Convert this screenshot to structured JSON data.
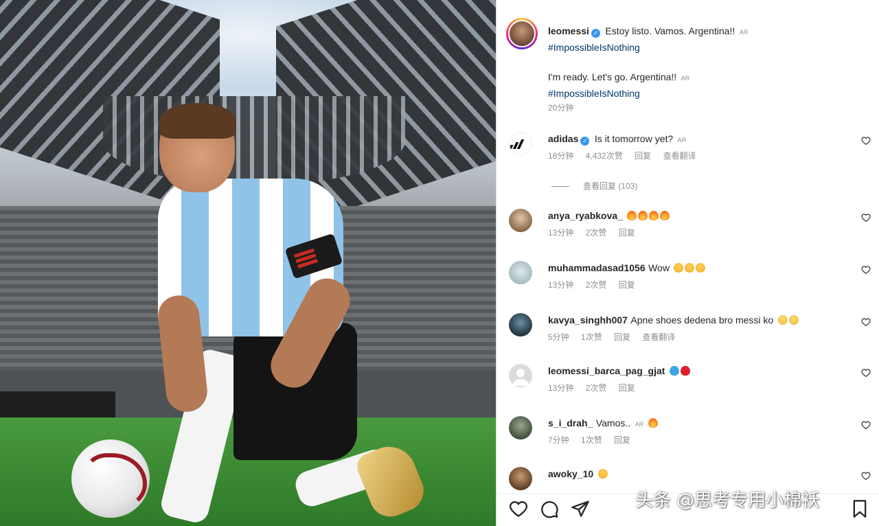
{
  "post": {
    "author": "leomessi",
    "caption_es": "Estoy listo. Vamos. Argentina!!",
    "hashtag_1": "#ImpossibleIsNothing",
    "caption_en": "I'm ready. Let's go. Argentina!!",
    "hashtag_2": "#ImpossibleIsNothing",
    "time": "20分钟",
    "ar_tag": "AR"
  },
  "comments": [
    {
      "user": "adidas",
      "verified": true,
      "text": "Is it tomorrow yet?",
      "tag": "AR",
      "time": "18分钟",
      "likes": "4,432次赞",
      "reply": "回复",
      "translate": "查看翻译",
      "emojis": []
    },
    {
      "user": "anya_ryabkova_",
      "text": "",
      "time": "13分钟",
      "likes": "2次赞",
      "reply": "回复",
      "emojis": [
        "fire",
        "fire",
        "fire",
        "fire"
      ]
    },
    {
      "user": "muhammadasad1056",
      "text": "Wow",
      "time": "13分钟",
      "likes": "2次赞",
      "reply": "回复",
      "emojis": [
        "heart-eyes",
        "heart-eyes",
        "heart-eyes"
      ]
    },
    {
      "user": "kavya_singhh007",
      "text": "Apne shoes dedena bro messi ko",
      "time": "5分钟",
      "likes": "1次赞",
      "reply": "回复",
      "translate": "查看翻译",
      "emojis": [
        "sob",
        "sob"
      ]
    },
    {
      "user": "leomessi_barca_pag_gjat",
      "text": "",
      "time": "13分钟",
      "likes": "2次赞",
      "reply": "回复",
      "emojis": [
        "blue-heart",
        "red-heart"
      ]
    },
    {
      "user": "s_i_drah_",
      "text": "Vamos..",
      "tag": "AR",
      "time": "7分钟",
      "likes": "1次赞",
      "reply": "回复",
      "emojis": [
        "fire"
      ]
    },
    {
      "user": "awoky_10",
      "text": "",
      "time": "",
      "likes": "",
      "reply": "",
      "emojis": [
        "heart-eyes"
      ]
    }
  ],
  "view_replies": "查看回复 (103)",
  "actions": [
    "like-icon",
    "comment-icon",
    "share-icon",
    "save-icon"
  ],
  "colors": {
    "verified": "#3897f0",
    "hashtag": "#00376b",
    "meta": "#8e8e8e"
  },
  "watermark": "头条 @思考专用小棉袄"
}
